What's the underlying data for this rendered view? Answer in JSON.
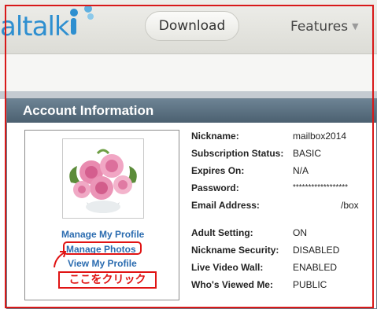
{
  "header": {
    "logo_text": "altalk",
    "logo_reg": "®",
    "download_label": "Download",
    "features_label": "Features"
  },
  "panel": {
    "title": "Account Information",
    "photo_caption": "",
    "links": {
      "manage_profile": "Manage My Profile",
      "manage_photos": "Manage Photos",
      "view_profile": "View My Profile"
    },
    "annotation": "ここをクリック"
  },
  "account": [
    {
      "label": "Nickname:",
      "value": "mailbox2014"
    },
    {
      "label": "Subscription Status:",
      "value": "BASIC"
    },
    {
      "label": "Expires On:",
      "value": "N/A"
    },
    {
      "label": "Password:",
      "value": "******************"
    },
    {
      "label": "Email Address:",
      "value": "/box"
    }
  ],
  "settings": [
    {
      "label": "Adult Setting:",
      "value": "ON"
    },
    {
      "label": "Nickname Security:",
      "value": "DISABLED"
    },
    {
      "label": "Live Video Wall:",
      "value": "ENABLED"
    },
    {
      "label": "Who's Viewed Me:",
      "value": "PUBLIC"
    }
  ],
  "colors": {
    "link": "#2b6cb0",
    "annotation": "#e01414",
    "header_bar": "#5a6f80",
    "logo": "#2e8fd0"
  }
}
